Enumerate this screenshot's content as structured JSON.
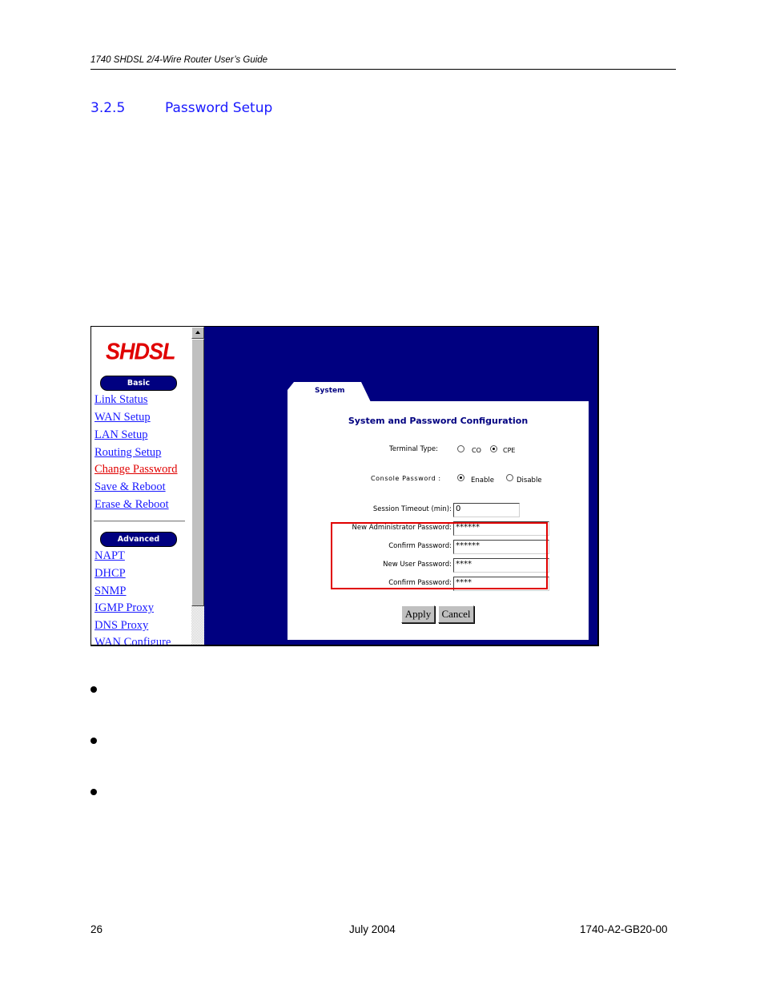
{
  "page": {
    "running_head": "1740 SHDSL 2/4-Wire Router User’s Guide",
    "section_number": "3.2.5",
    "section_title": "Password Setup",
    "footer": {
      "page_number": "26",
      "date": "July 2004",
      "doc_id": "1740-A2-GB20-00"
    },
    "bullet_count": 3
  },
  "screenshot": {
    "logo": "SHDSL",
    "basic_label": "Basic",
    "basic_links": [
      "Link Status",
      "WAN Setup",
      "LAN Setup",
      "Routing Setup",
      "Change Password",
      "Save & Reboot",
      "Erase & Reboot"
    ],
    "active_link": "Change Password",
    "advanced_label": "Advanced",
    "advanced_links": [
      "NAPT",
      "DHCP",
      "SNMP",
      "IGMP Proxy",
      "DNS Proxy",
      "WAN Configure"
    ],
    "tab_label": "System",
    "panel_title": "System and Password Configuration",
    "terminal_type": {
      "label": "Terminal Type:",
      "options": [
        "CO",
        "CPE"
      ],
      "selected": "CPE"
    },
    "console_password": {
      "label": "Console Password :",
      "options": [
        "Enable",
        "Disable"
      ],
      "selected": "Enable"
    },
    "fields": [
      {
        "label": "Session Timeout (min):",
        "value": "0"
      },
      {
        "label": "New Administrator Password:",
        "value": "******"
      },
      {
        "label": "Confirm Password:",
        "value": "******"
      },
      {
        "label": "New User Password:",
        "value": "****"
      },
      {
        "label": "Confirm Password:",
        "value": "****"
      }
    ],
    "buttons": {
      "apply": "Apply",
      "cancel": "Cancel"
    },
    "colors": {
      "frame_bg": "#000080",
      "link": "#1a1aff",
      "active_link": "#e00000",
      "highlight_box": "#e00000"
    }
  }
}
